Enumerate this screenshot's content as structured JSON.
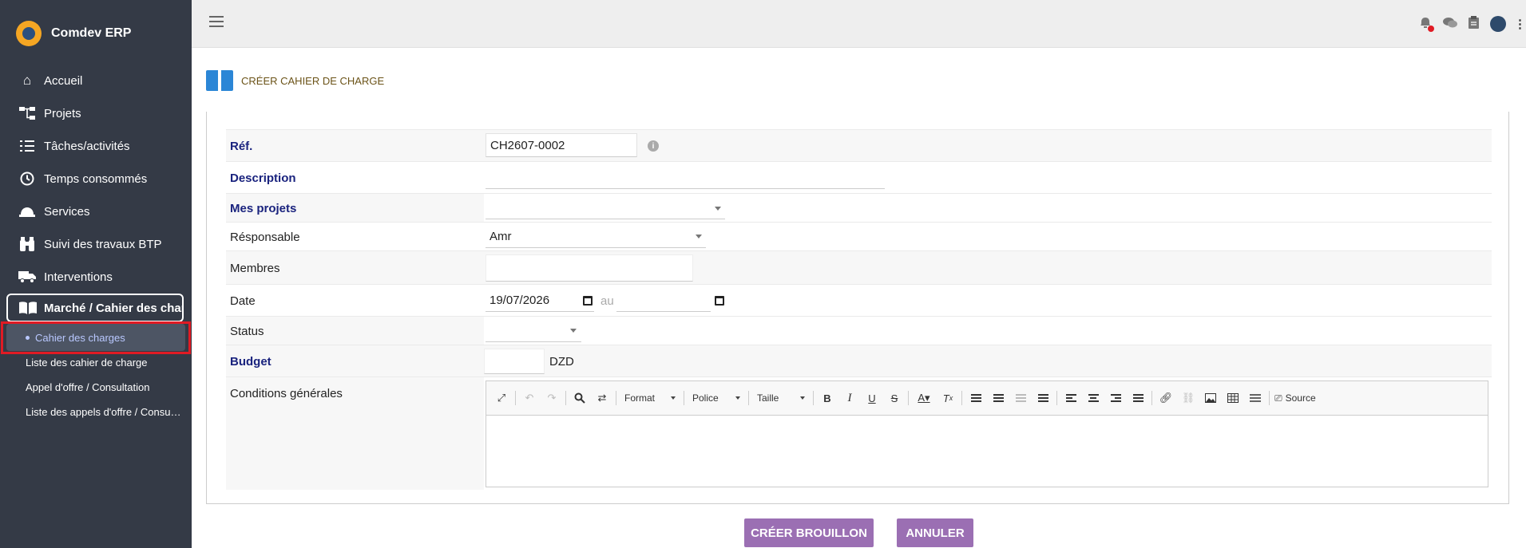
{
  "app": {
    "name": "Comdev ERP"
  },
  "sidebar": {
    "items": [
      {
        "label": "Accueil",
        "icon": "home-icon"
      },
      {
        "label": "Projets",
        "icon": "sitemap-icon"
      },
      {
        "label": "Tâches/activités",
        "icon": "tasks-icon"
      },
      {
        "label": "Temps consommés",
        "icon": "clock-icon"
      },
      {
        "label": "Services",
        "icon": "bell-service-icon"
      },
      {
        "label": "Suivi des travaux BTP",
        "icon": "binoculars-icon"
      },
      {
        "label": "Interventions",
        "icon": "truck-icon"
      },
      {
        "label": "Marché / Cahier des charges",
        "icon": "book-open-icon"
      }
    ],
    "active_sub": "Cahier des charges",
    "sub_items": [
      "Liste des cahier de charge",
      "Appel d'offre / Consultation",
      "Liste des appels d'offre / Consultation"
    ]
  },
  "topbar": {
    "icons": [
      "menu-icon",
      "notification-bell-icon",
      "comments-icon",
      "clipboard-icon",
      "user-avatar",
      "more-vertical-icon"
    ]
  },
  "page": {
    "title": "CRÉER CAHIER DE CHARGE"
  },
  "form": {
    "ref": {
      "label": "Réf.",
      "value": "CH2607-0002"
    },
    "description": {
      "label": "Description",
      "value": ""
    },
    "mes_projets": {
      "label": "Mes projets",
      "value": ""
    },
    "responsable": {
      "label": "Résponsable",
      "value": "Amr"
    },
    "membres": {
      "label": "Membres",
      "value": ""
    },
    "date": {
      "label": "Date",
      "start": "19/07/2026",
      "separator": "au",
      "end": ""
    },
    "status": {
      "label": "Status",
      "value": ""
    },
    "budget": {
      "label": "Budget",
      "value": "",
      "currency": "DZD"
    },
    "conditions": {
      "label": "Conditions générales"
    }
  },
  "editor": {
    "format_label": "Format",
    "font_label": "Police",
    "size_label": "Taille",
    "source_label": "Source"
  },
  "actions": {
    "create_label": "CRÉER BROUILLON",
    "cancel_label": "ANNULER"
  },
  "colors": {
    "sidebar_bg": "#343a46",
    "button": "#9b6fb3",
    "required_label": "#1a237e",
    "highlight": "#e01b24"
  }
}
